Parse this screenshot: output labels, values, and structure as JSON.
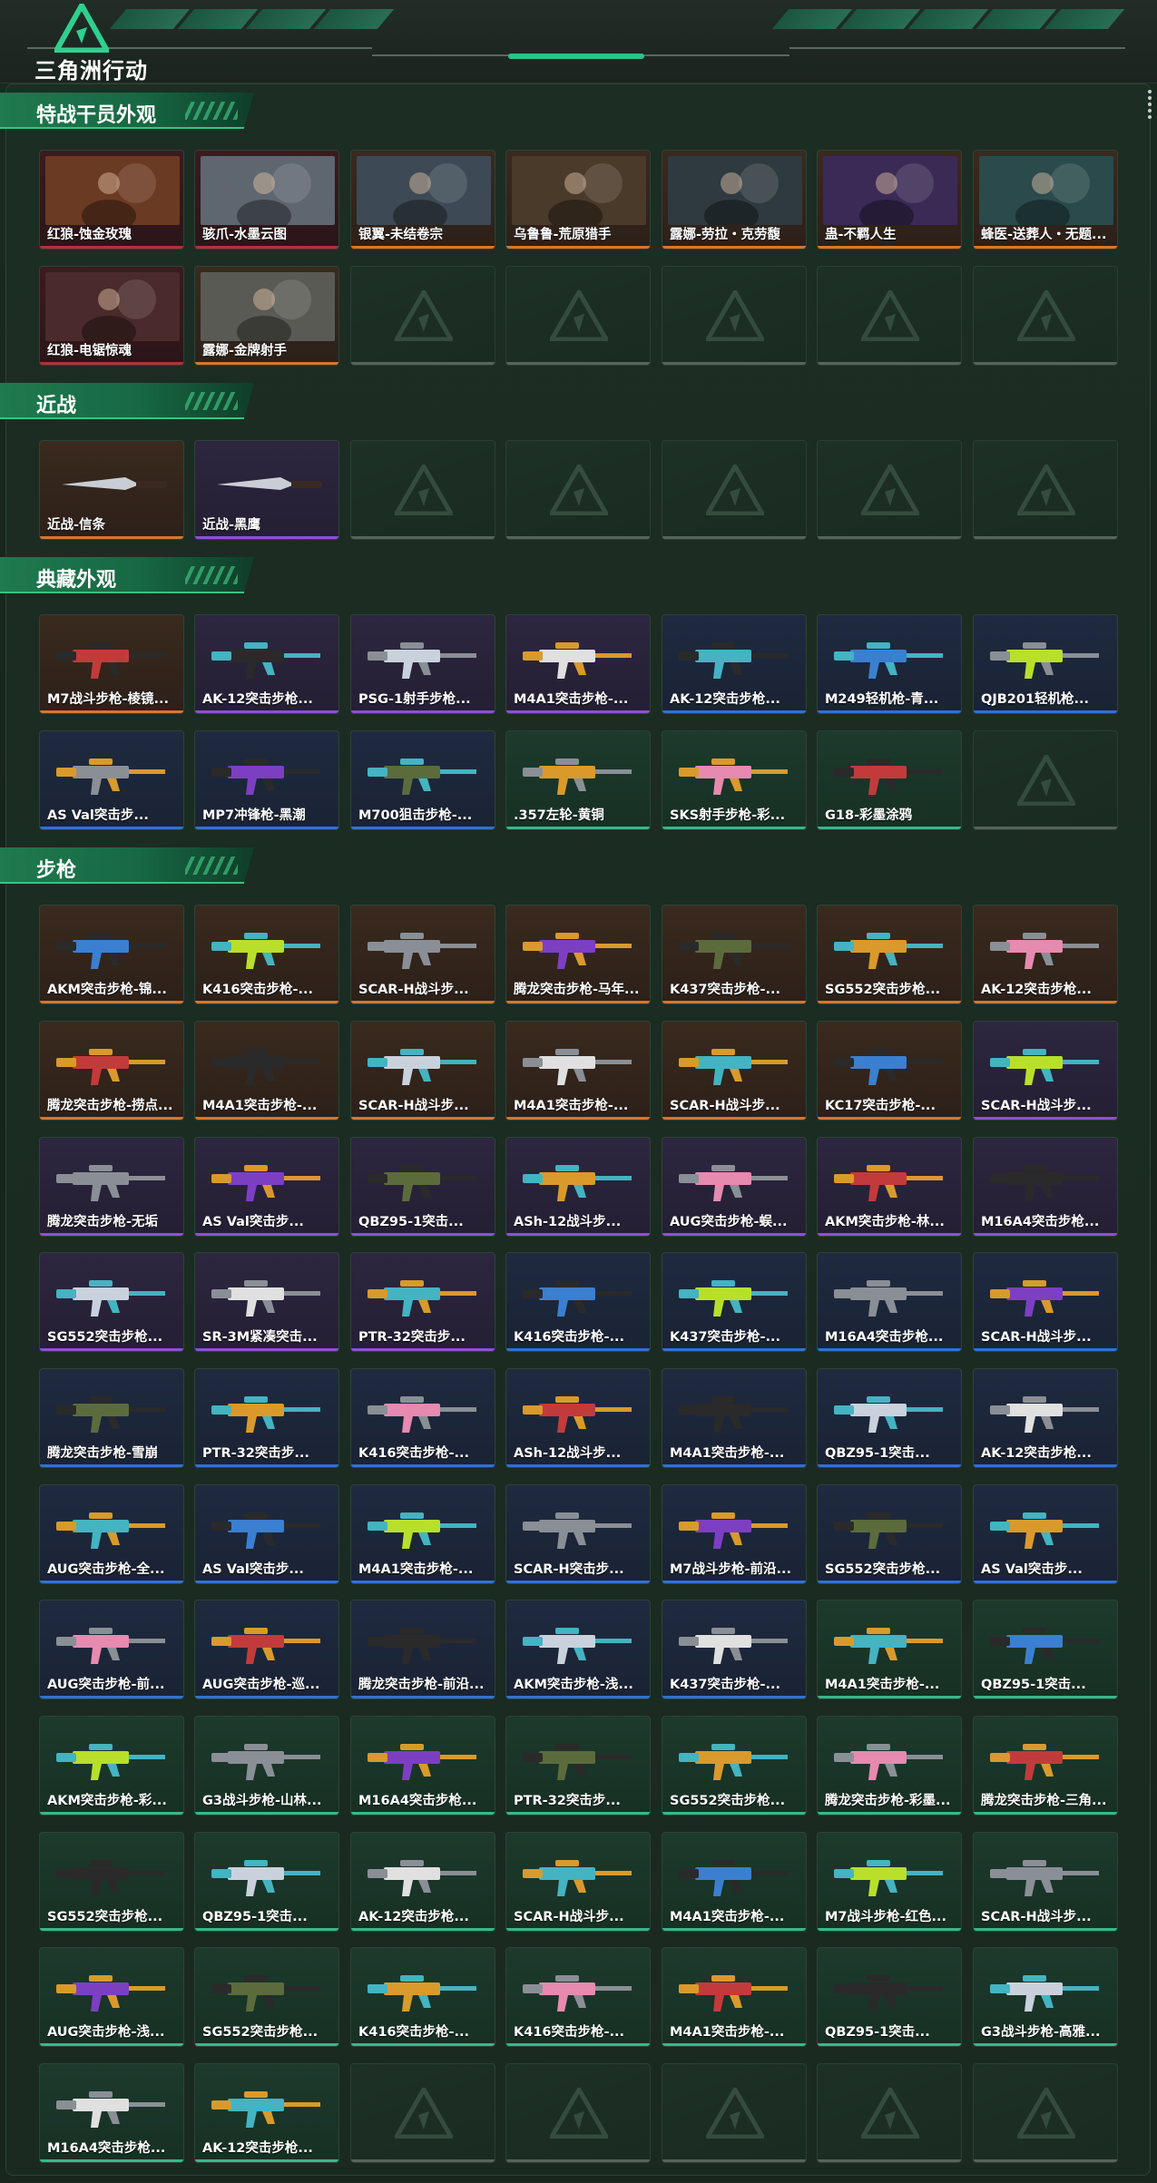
{
  "header": {
    "logo_text": "三角洲行动"
  },
  "rarity_colors": {
    "orange": "#d8762d",
    "purple": "#8f4fd8",
    "blue": "#2f72d6",
    "green": "#35b98c",
    "red": "#b23236"
  },
  "sections": [
    {
      "title": "特战干员外观",
      "items": [
        {
          "label": "红狼-蚀金玫瑰",
          "rarity": "red"
        },
        {
          "label": "骇爪-水墨云图",
          "rarity": "red"
        },
        {
          "label": "银翼-未结卷宗",
          "rarity": "orange"
        },
        {
          "label": "乌鲁鲁-荒原猎手",
          "rarity": "orange"
        },
        {
          "label": "露娜-劳拉・克劳馥",
          "rarity": "orange"
        },
        {
          "label": "蛊-不羁人生",
          "rarity": "orange"
        },
        {
          "label": "蜂医-送葬人・无题...",
          "rarity": "orange"
        },
        {
          "label": "红狼-电锯惊魂",
          "rarity": "red"
        },
        {
          "label": "露娜-金牌射手",
          "rarity": "orange"
        }
      ]
    },
    {
      "title": "近战",
      "items": [
        {
          "label": "近战-信条",
          "rarity": "orange"
        },
        {
          "label": "近战-黑鹰",
          "rarity": "purple"
        }
      ]
    },
    {
      "title": "典藏外观",
      "items": [
        {
          "label": "M7战斗步枪-棱镜...",
          "rarity": "orange"
        },
        {
          "label": "AK-12突击步枪...",
          "rarity": "purple"
        },
        {
          "label": "PSG-1射手步枪...",
          "rarity": "purple"
        },
        {
          "label": "M4A1突击步枪-...",
          "rarity": "purple"
        },
        {
          "label": "AK-12突击步枪...",
          "rarity": "blue"
        },
        {
          "label": "M249轻机枪-青...",
          "rarity": "blue"
        },
        {
          "label": "QJB201轻机枪...",
          "rarity": "blue"
        },
        {
          "label": "AS Val突击步...",
          "rarity": "blue"
        },
        {
          "label": "MP7冲锋枪-黑潮",
          "rarity": "blue"
        },
        {
          "label": "M700狙击步枪-...",
          "rarity": "blue"
        },
        {
          "label": ".357左轮-黄铜",
          "rarity": "green"
        },
        {
          "label": "SKS射手步枪-彩...",
          "rarity": "green"
        },
        {
          "label": "G18-彩墨涂鸦",
          "rarity": "green"
        }
      ]
    },
    {
      "title": "步枪",
      "items": [
        {
          "label": "AKM突击步枪-锦...",
          "rarity": "orange"
        },
        {
          "label": "K416突击步枪-...",
          "rarity": "orange"
        },
        {
          "label": "SCAR-H战斗步...",
          "rarity": "orange"
        },
        {
          "label": "腾龙突击步枪-马年...",
          "rarity": "orange"
        },
        {
          "label": "K437突击步枪-...",
          "rarity": "orange"
        },
        {
          "label": "SG552突击步枪...",
          "rarity": "orange"
        },
        {
          "label": "AK-12突击步枪...",
          "rarity": "orange"
        },
        {
          "label": "腾龙突击步枪-捞点...",
          "rarity": "orange"
        },
        {
          "label": "M4A1突击步枪-...",
          "rarity": "orange"
        },
        {
          "label": "SCAR-H战斗步...",
          "rarity": "orange"
        },
        {
          "label": "M4A1突击步枪-...",
          "rarity": "orange"
        },
        {
          "label": "SCAR-H战斗步...",
          "rarity": "orange"
        },
        {
          "label": "KC17突击步枪-...",
          "rarity": "orange"
        },
        {
          "label": "SCAR-H战斗步...",
          "rarity": "purple"
        },
        {
          "label": "腾龙突击步枪-无垢",
          "rarity": "purple"
        },
        {
          "label": "AS Val突击步...",
          "rarity": "purple"
        },
        {
          "label": "QBZ95-1突击...",
          "rarity": "purple"
        },
        {
          "label": "ASh-12战斗步...",
          "rarity": "purple"
        },
        {
          "label": "AUG突击步枪-蜈...",
          "rarity": "purple"
        },
        {
          "label": "AKM突击步枪-林...",
          "rarity": "purple"
        },
        {
          "label": "M16A4突击步枪...",
          "rarity": "purple"
        },
        {
          "label": "SG552突击步枪...",
          "rarity": "purple"
        },
        {
          "label": "SR-3M紧凑突击...",
          "rarity": "purple"
        },
        {
          "label": "PTR-32突击步...",
          "rarity": "purple"
        },
        {
          "label": "K416突击步枪-...",
          "rarity": "blue"
        },
        {
          "label": "K437突击步枪-...",
          "rarity": "blue"
        },
        {
          "label": "M16A4突击步枪...",
          "rarity": "blue"
        },
        {
          "label": "SCAR-H战斗步...",
          "rarity": "blue"
        },
        {
          "label": "腾龙突击步枪-雪崩",
          "rarity": "blue"
        },
        {
          "label": "PTR-32突击步...",
          "rarity": "blue"
        },
        {
          "label": "K416突击步枪-...",
          "rarity": "blue"
        },
        {
          "label": "ASh-12战斗步...",
          "rarity": "blue"
        },
        {
          "label": "M4A1突击步枪-...",
          "rarity": "blue"
        },
        {
          "label": "QBZ95-1突击...",
          "rarity": "blue"
        },
        {
          "label": "AK-12突击步枪...",
          "rarity": "blue"
        },
        {
          "label": "AUG突击步枪-全...",
          "rarity": "blue"
        },
        {
          "label": "AS Val突击步...",
          "rarity": "blue"
        },
        {
          "label": "M4A1突击步枪-...",
          "rarity": "blue"
        },
        {
          "label": "SCAR-H突击步...",
          "rarity": "blue"
        },
        {
          "label": "M7战斗步枪-前沿...",
          "rarity": "blue"
        },
        {
          "label": "SG552突击步枪...",
          "rarity": "blue"
        },
        {
          "label": "AS Val突击步...",
          "rarity": "blue"
        },
        {
          "label": "AUG突击步枪-前...",
          "rarity": "blue"
        },
        {
          "label": "AUG突击步枪-巡...",
          "rarity": "blue"
        },
        {
          "label": "腾龙突击步枪-前沿...",
          "rarity": "blue"
        },
        {
          "label": "AKM突击步枪-浅...",
          "rarity": "blue"
        },
        {
          "label": "K437突击步枪-...",
          "rarity": "blue"
        },
        {
          "label": "M4A1突击步枪-...",
          "rarity": "green"
        },
        {
          "label": "QBZ95-1突击...",
          "rarity": "green"
        },
        {
          "label": "AKM突击步枪-彩...",
          "rarity": "green"
        },
        {
          "label": "G3战斗步枪-山林...",
          "rarity": "green"
        },
        {
          "label": "M16A4突击步枪...",
          "rarity": "green"
        },
        {
          "label": "PTR-32突击步...",
          "rarity": "green"
        },
        {
          "label": "SG552突击步枪...",
          "rarity": "green"
        },
        {
          "label": "腾龙突击步枪-彩墨...",
          "rarity": "green"
        },
        {
          "label": "腾龙突击步枪-三角...",
          "rarity": "green"
        },
        {
          "label": "SG552突击步枪...",
          "rarity": "green"
        },
        {
          "label": "QBZ95-1突击...",
          "rarity": "green"
        },
        {
          "label": "AK-12突击步枪...",
          "rarity": "green"
        },
        {
          "label": "SCAR-H战斗步...",
          "rarity": "green"
        },
        {
          "label": "M4A1突击步枪-...",
          "rarity": "green"
        },
        {
          "label": "M7战斗步枪-红色...",
          "rarity": "green"
        },
        {
          "label": "SCAR-H战斗步...",
          "rarity": "green"
        },
        {
          "label": "AUG突击步枪-浅...",
          "rarity": "green"
        },
        {
          "label": "SG552突击步枪...",
          "rarity": "green"
        },
        {
          "label": "K416突击步枪-...",
          "rarity": "green"
        },
        {
          "label": "K416突击步枪-...",
          "rarity": "green"
        },
        {
          "label": "M4A1突击步枪-...",
          "rarity": "green"
        },
        {
          "label": "QBZ95-1突击...",
          "rarity": "green"
        },
        {
          "label": "G3战斗步枪-高雅...",
          "rarity": "green"
        },
        {
          "label": "M16A4突击步枪...",
          "rarity": "green"
        },
        {
          "label": "AK-12突击步枪...",
          "rarity": "green"
        }
      ]
    }
  ]
}
